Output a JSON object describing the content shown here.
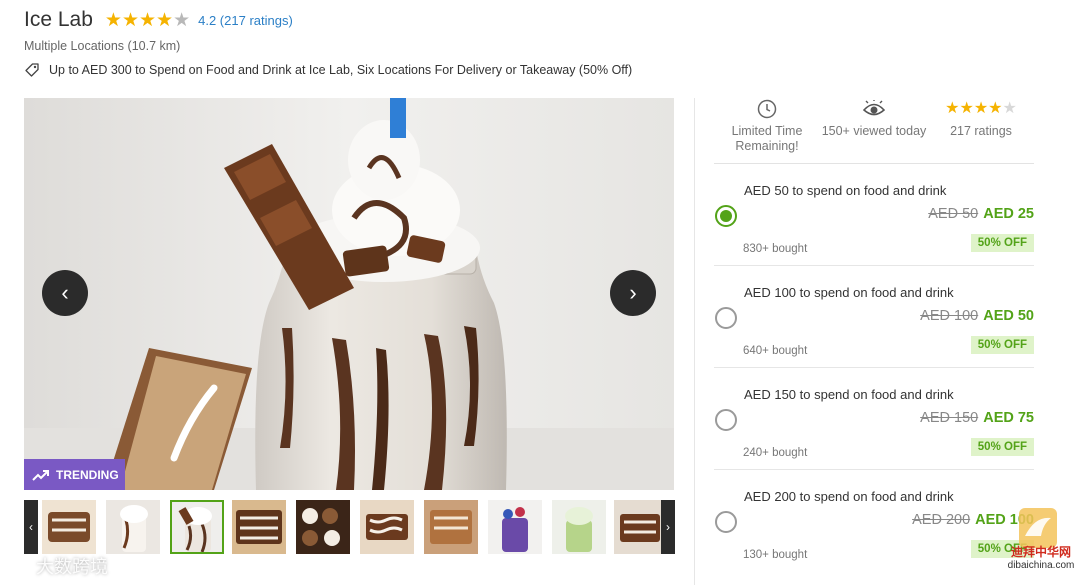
{
  "header": {
    "title": "Ice Lab",
    "rating_value": 4.2,
    "rating_text": "4.2 (217 ratings)",
    "location": "Multiple Locations (10.7 km)",
    "deal_title": "Up to AED 300 to Spend on Food and Drink at Ice Lab, Six Locations For Delivery or Takeaway (50% Off)"
  },
  "gallery": {
    "badge": "TRENDING",
    "prev_label": "‹",
    "next_label": "›",
    "thumb_prev": "‹",
    "thumb_next": "›",
    "thumb_count": 10,
    "active_thumb": 3
  },
  "stats": {
    "limited": "Limited Time Remaining!",
    "viewed": "150+ viewed today",
    "ratings": "217 ratings",
    "rating_stars": 4
  },
  "options": [
    {
      "title": "AED 50 to spend on food and drink",
      "old_price": "AED 50",
      "new_price": "AED 25",
      "bought": "830+ bought",
      "discount": "50% OFF",
      "selected": true
    },
    {
      "title": "AED 100 to spend on food and drink",
      "old_price": "AED 100",
      "new_price": "AED 50",
      "bought": "640+ bought",
      "discount": "50% OFF",
      "selected": false
    },
    {
      "title": "AED 150 to spend on food and drink",
      "old_price": "AED 150",
      "new_price": "AED 75",
      "bought": "240+ bought",
      "discount": "50% OFF",
      "selected": false
    },
    {
      "title": "AED 200 to spend on food and drink",
      "old_price": "AED 200",
      "new_price": "AED 100",
      "bought": "130+ bought",
      "discount": "50% OFF",
      "selected": false
    }
  ],
  "watermarks": {
    "left": "大数跨境",
    "right_name": "迪拜中华网",
    "right_url": "dibaichina.com"
  },
  "colors": {
    "link_blue": "#2b7fc6",
    "star_gold": "#f5b301",
    "green": "#53a318",
    "trending_purple": "#7a59c4"
  }
}
